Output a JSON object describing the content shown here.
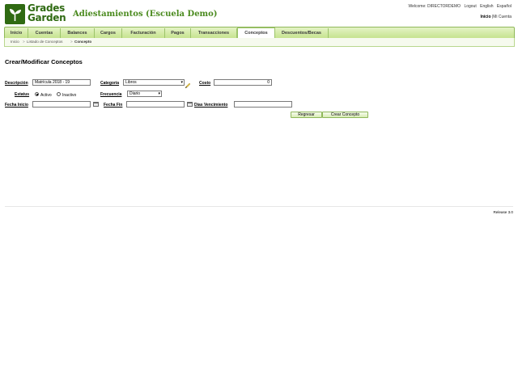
{
  "app": {
    "logo_line1": "Grades",
    "logo_line2": "Garden",
    "school_title": "Adiestamientos (Escuela Demo)"
  },
  "top_links": {
    "welcome": "Welcome: DIRECTORDEMO",
    "logout": "Logout",
    "english": "English",
    "spanish": "Español",
    "home": "Inicio",
    "separator": "|",
    "my_account": "Mi Cuenta"
  },
  "nav": {
    "items": [
      {
        "label": "Inicio"
      },
      {
        "label": "Cuentas"
      },
      {
        "label": "Balances"
      },
      {
        "label": "Cargos"
      },
      {
        "label": "Facturación"
      },
      {
        "label": "Pagos"
      },
      {
        "label": "Transacciones"
      },
      {
        "label": "Conceptos"
      },
      {
        "label": "Descuentos/Becas"
      }
    ],
    "active": "Conceptos"
  },
  "breadcrumb": {
    "items": [
      "Inicio",
      "Listado de Conceptos",
      "Concepto"
    ],
    "separator": ">"
  },
  "form": {
    "title": "Crear/Modificar Conceptos",
    "descripcion_label": "Descripción",
    "descripcion_value": "Matrícula 2018 - 19",
    "categoria_label": "Categoría",
    "categoria_value": "Libros",
    "costo_label": "Costo",
    "costo_value": "0",
    "estatus_label": "Estatus",
    "estatus_active": "Activo",
    "estatus_inactive": "Inactivo",
    "frecuencia_label": "Frecuencia",
    "frecuencia_value": "Diario",
    "fecha_inicio_label": "Fecha Inicio",
    "fecha_inicio_value": "",
    "fecha_fin_label": "Fecha Fin",
    "fecha_fin_value": "",
    "dias_vencimiento_label": "Dias Vencimiento",
    "dias_vencimiento_value": "",
    "back_button": "Regresar",
    "create_button": "Crear Concepto"
  },
  "footer": {
    "release": "Release 3.0"
  },
  "colors": {
    "brand_green": "#2f6a12",
    "title_green": "#4a8a1e",
    "nav_bg": "#c4e28b"
  }
}
